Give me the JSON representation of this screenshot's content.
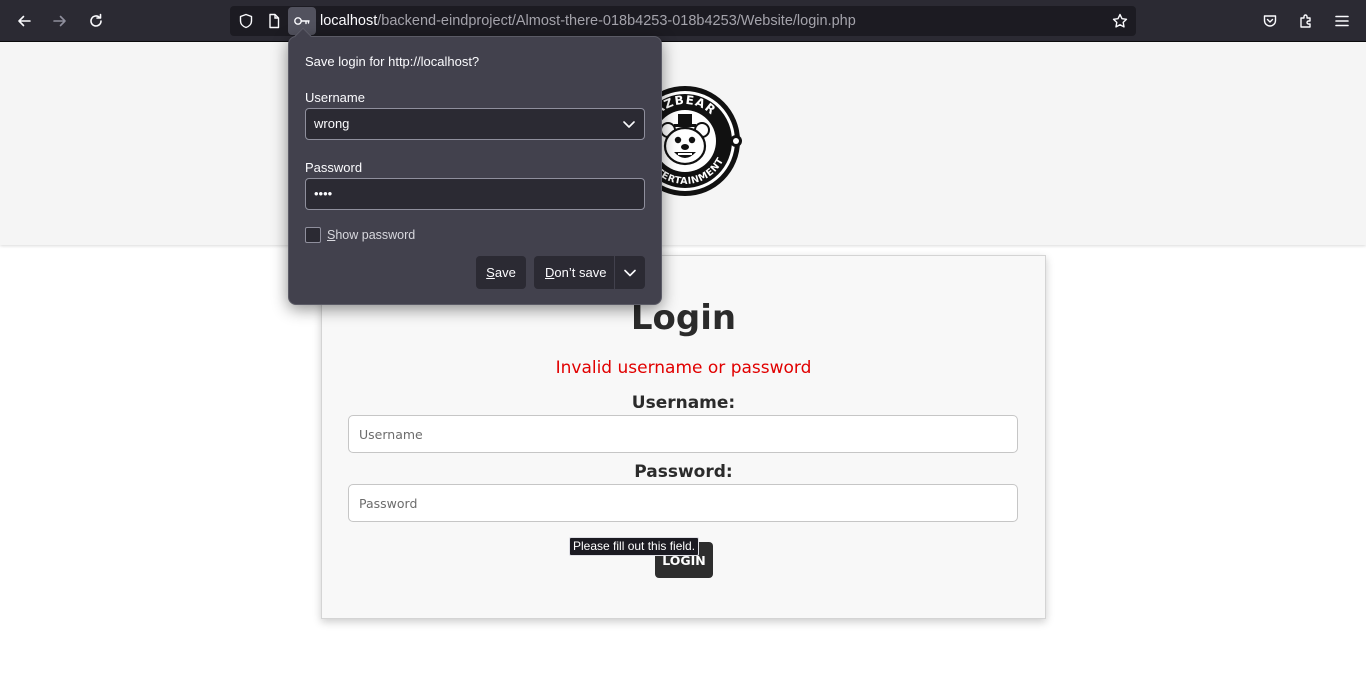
{
  "browser": {
    "url_host": "localhost",
    "url_path": "/backend-eindproject/Almost-there-018b4253-018b4253/Website/login.php",
    "icons": [
      "back-arrow-icon",
      "forward-arrow-icon",
      "reload-icon",
      "shield-icon",
      "page-icon",
      "key-icon",
      "star-icon",
      "pocket-icon",
      "extensions-icon",
      "menu-icon"
    ]
  },
  "logo": {
    "text_top": "AZBEAR",
    "text_bottom": "ENTERTAINMENT"
  },
  "login_card": {
    "title": "Login",
    "error": "Invalid username or password",
    "username_label": "Username:",
    "username_placeholder": "Username",
    "password_label": "Password:",
    "password_placeholder": "Password",
    "login_button": "LOGIN",
    "validation_tooltip": "Please fill out this field."
  },
  "save_login_popup": {
    "title": "Save login for http://localhost?",
    "username_label": "Username",
    "username_value": "wrong",
    "password_label": "Password",
    "password_value": "••••",
    "show_password_label_first": "S",
    "show_password_label_rest": "how password",
    "show_password_checked": false,
    "save_button_first": "S",
    "save_button_rest": "ave",
    "dont_save_first": "D",
    "dont_save_rest": "on’t save"
  },
  "colors": {
    "toolbar": "#2b2a33",
    "popup": "#42414d",
    "error": "#e10000",
    "login_button": "#2e2e2e"
  }
}
